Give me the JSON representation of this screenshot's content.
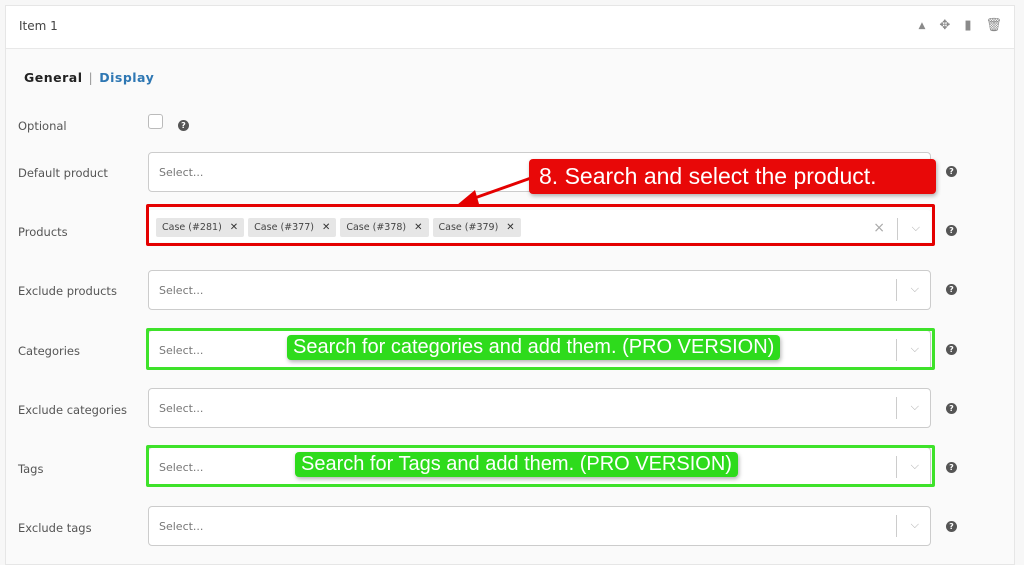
{
  "header": {
    "title": "Item 1",
    "icons": [
      "collapse-arrow-icon",
      "move-icon",
      "duplicate-icon",
      "trash-icon"
    ]
  },
  "tabs": {
    "general": "General",
    "separator": "|",
    "display": "Display"
  },
  "fields": {
    "optional": {
      "label": "Optional"
    },
    "default_product": {
      "label": "Default product",
      "placeholder": "Select..."
    },
    "products": {
      "label": "Products",
      "tags": [
        "Case (#281)",
        "Case (#377)",
        "Case (#378)",
        "Case (#379)"
      ]
    },
    "exclude_products": {
      "label": "Exclude products",
      "placeholder": "Select..."
    },
    "categories": {
      "label": "Categories",
      "placeholder": "Select..."
    },
    "exclude_categories": {
      "label": "Exclude categories",
      "placeholder": "Select..."
    },
    "tags": {
      "label": "Tags",
      "placeholder": "Select..."
    },
    "exclude_tags": {
      "label": "Exclude tags",
      "placeholder": "Select..."
    }
  },
  "annotations": {
    "products": "8. Search and select the product.",
    "categories": "Search for categories and add them. (PRO VERSION)",
    "tags": "Search for Tags and add them. (PRO VERSION)"
  },
  "colors": {
    "red": "#e80808",
    "green": "#2edb1c",
    "accent": "#2e77b3"
  }
}
